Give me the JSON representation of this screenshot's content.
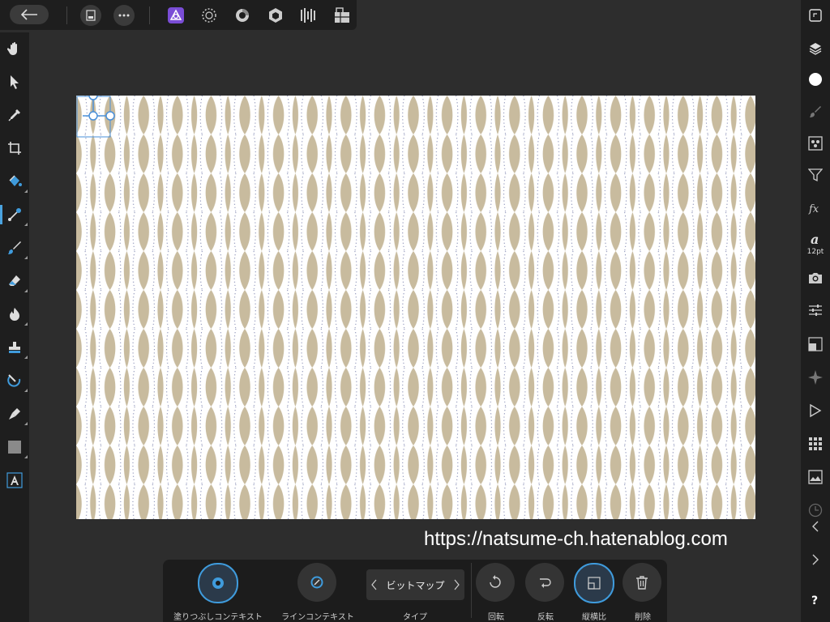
{
  "toolbar": {
    "back_icon": "arrow-left-icon",
    "menu_icon": "ellipsis-icon"
  },
  "personas": [
    "photo-persona-icon",
    "liquify-persona-icon",
    "develop-persona-icon",
    "tone-mapping-persona-icon",
    "export-persona-icon"
  ],
  "left_tools": [
    "hand-tool",
    "move-tool",
    "color-picker-tool",
    "crop-tool",
    "flood-fill-tool",
    "gradient-tool",
    "paint-brush-tool",
    "erase-brush-tool",
    "dodge-tool",
    "clone-tool",
    "red-eye-tool",
    "pen-tool",
    "rectangle-tool",
    "text-tool"
  ],
  "right_panel": {
    "font_size_label": "12pt"
  },
  "watermark": "https://natsume-ch.hatenablog.com",
  "context_toolbar": {
    "fill_context": "塗りつぶしコンテキスト",
    "line_context": "ラインコンテキスト",
    "type_value": "ビットマップ",
    "type_label": "タイプ",
    "rotate": "回転",
    "flip": "反転",
    "aspect": "縦横比",
    "delete": "削除"
  },
  "colors": {
    "accent": "#3f9bdc",
    "pattern_fill": "#c8bb9e",
    "pattern_dots": "#7f86b0"
  }
}
